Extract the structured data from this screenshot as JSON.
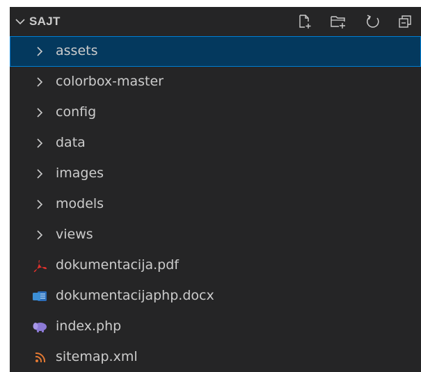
{
  "explorer": {
    "title": "SAJT",
    "actions": [
      "new-file-icon",
      "new-folder-icon",
      "refresh-icon",
      "collapse-all-icon"
    ],
    "folders": [
      {
        "label": "assets",
        "selected": true
      },
      {
        "label": "colorbox-master",
        "selected": false
      },
      {
        "label": "config",
        "selected": false
      },
      {
        "label": "data",
        "selected": false
      },
      {
        "label": "images",
        "selected": false
      },
      {
        "label": "models",
        "selected": false
      },
      {
        "label": "views",
        "selected": false
      }
    ],
    "files": [
      {
        "label": "dokumentacija.pdf",
        "icon": "pdf-icon"
      },
      {
        "label": "dokumentacijaphp.docx",
        "icon": "word-doc-icon"
      },
      {
        "label": "index.php",
        "icon": "php-icon"
      },
      {
        "label": "sitemap.xml",
        "icon": "rss-xml-icon"
      }
    ]
  },
  "colors": {
    "background": "#252526",
    "selection": "#04395e",
    "selection_border": "#007fd4",
    "text": "#cccccc",
    "pdf": "#e0312c",
    "word": "#3c8fd6",
    "php": "#8c7ad6",
    "xml": "#e37933"
  }
}
